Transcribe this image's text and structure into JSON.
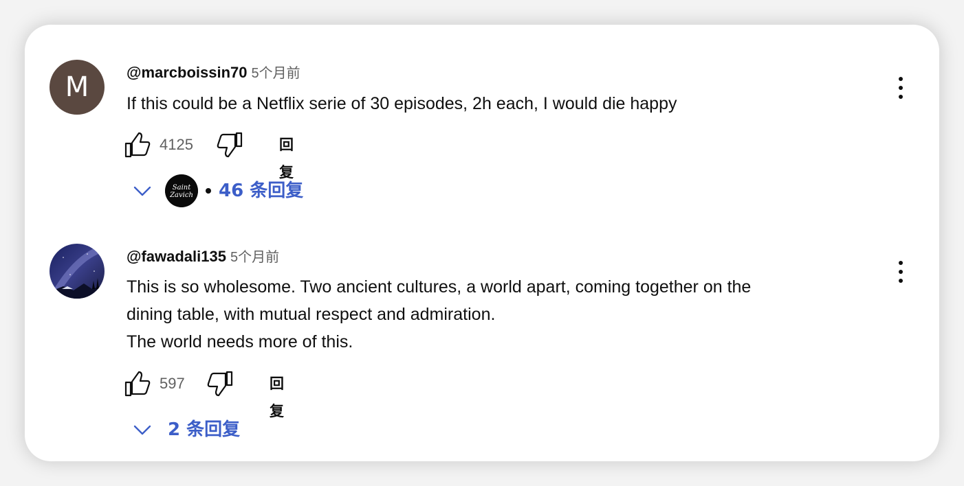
{
  "comments": [
    {
      "author": "@marcboissin70",
      "time": "5个月前",
      "avatar_letter": "M",
      "avatar_color": "#5a4840",
      "lines": [
        "If this could be a Netflix serie of 30 episodes, 2h each, I would die happy"
      ],
      "likes": "4125",
      "reply_label": "回复",
      "replies_label": "46 条回复",
      "reply_avatar_text": "Saint Zavich"
    },
    {
      "author": "@fawadali135",
      "time": "5个月前",
      "lines": [
        "This is so wholesome. Two ancient cultures, a world apart, coming together on the",
        "dining table, with mutual respect and admiration.",
        "The world needs more of this."
      ],
      "likes": "597",
      "reply_label": "回复",
      "replies_label": "2 条回复"
    }
  ],
  "icons": {
    "like": "thumbs-up-icon",
    "dislike": "thumbs-down-icon",
    "more": "more-vert-icon",
    "expand": "chevron-down-icon"
  },
  "colors": {
    "link_blue": "#3c5ec8",
    "text": "#0f0f0f",
    "secondary": "#606060"
  }
}
